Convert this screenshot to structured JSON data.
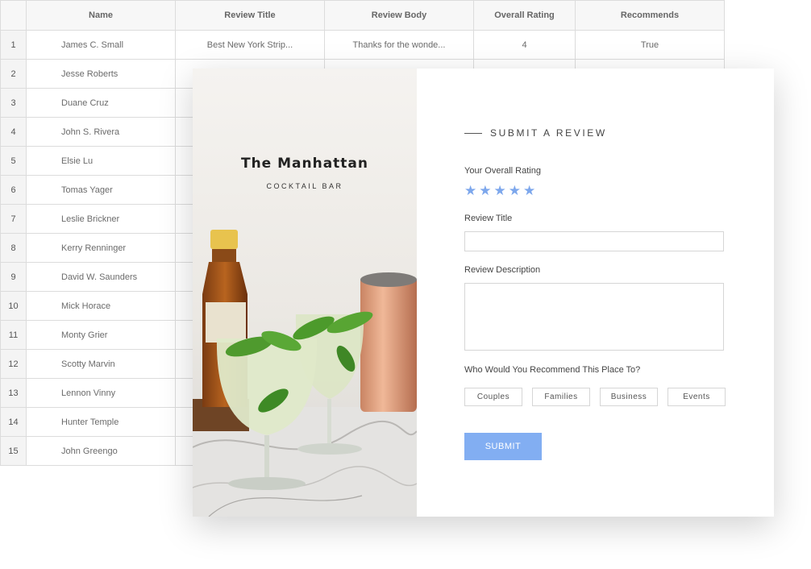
{
  "table": {
    "headers": [
      "Name",
      "Review Title",
      "Review Body",
      "Overall Rating",
      "Recommends"
    ],
    "rows": [
      {
        "index": "1",
        "name": "James C. Small",
        "title": "Best New York Strip...",
        "body": "Thanks for the wonde...",
        "rating": "4",
        "recommends": "True"
      },
      {
        "index": "2",
        "name": "Jesse Roberts"
      },
      {
        "index": "3",
        "name": "Duane Cruz"
      },
      {
        "index": "4",
        "name": "John S. Rivera"
      },
      {
        "index": "5",
        "name": "Elsie Lu"
      },
      {
        "index": "6",
        "name": "Tomas Yager"
      },
      {
        "index": "7",
        "name": "Leslie Brickner"
      },
      {
        "index": "8",
        "name": "Kerry Renninger"
      },
      {
        "index": "9",
        "name": "David W. Saunders"
      },
      {
        "index": "10",
        "name": "Mick Horace"
      },
      {
        "index": "11",
        "name": "Monty Grier"
      },
      {
        "index": "12",
        "name": "Scotty Marvin"
      },
      {
        "index": "13",
        "name": "Lennon Vinny"
      },
      {
        "index": "14",
        "name": "Hunter Temple"
      },
      {
        "index": "15",
        "name": "John Greengo"
      }
    ]
  },
  "venue": {
    "title": "The Manhattan",
    "subtitle": "COCKTAIL BAR"
  },
  "form": {
    "heading": "SUBMIT A REVIEW",
    "rating_label": "Your Overall Rating",
    "rating_value": 5,
    "star_icon": "star-icon",
    "star_color": "#7da7ec",
    "title_label": "Review Title",
    "title_value": "",
    "description_label": "Review Description",
    "description_value": "",
    "recommend_label": "Who Would You Recommend This Place To?",
    "recommend_options": [
      "Couples",
      "Families",
      "Business",
      "Events"
    ],
    "submit_label": "SUBMIT",
    "accent_color": "#82aef2"
  }
}
